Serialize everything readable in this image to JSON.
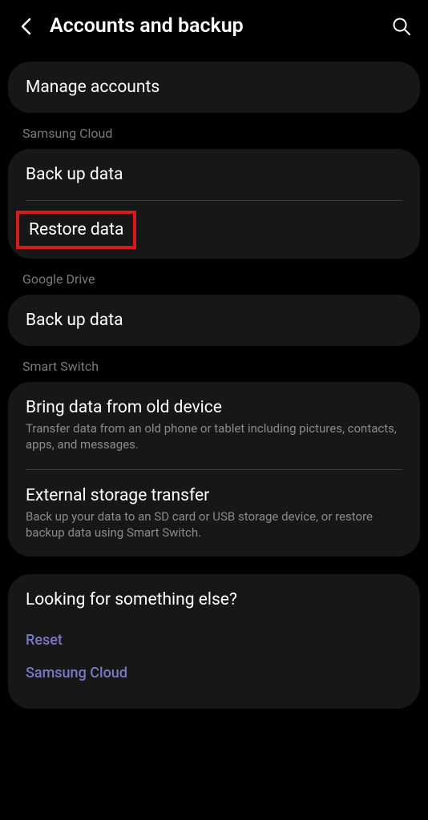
{
  "header": {
    "title": "Accounts and backup"
  },
  "sections": {
    "manage": {
      "label": "Manage accounts"
    },
    "samsungCloud": {
      "header": "Samsung Cloud",
      "backup": "Back up data",
      "restore": "Restore data"
    },
    "googleDrive": {
      "header": "Google Drive",
      "backup": "Back up data"
    },
    "smartSwitch": {
      "header": "Smart Switch",
      "bring": {
        "title": "Bring data from old device",
        "subtitle": "Transfer data from an old phone or tablet including pictures, contacts, apps, and messages."
      },
      "external": {
        "title": "External storage transfer",
        "subtitle": "Back up your data to an SD card or USB storage device, or restore backup data using Smart Switch."
      }
    }
  },
  "footer": {
    "title": "Looking for something else?",
    "links": {
      "reset": "Reset",
      "samsungCloud": "Samsung Cloud"
    }
  }
}
